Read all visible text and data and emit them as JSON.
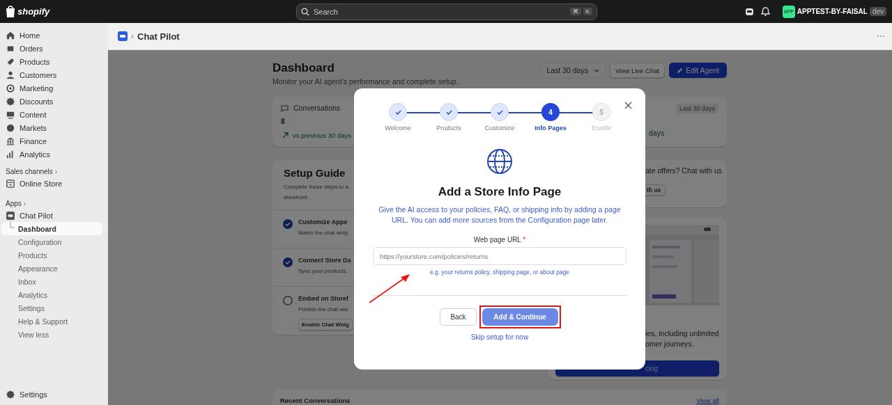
{
  "top_bar": {
    "logo_text": "shopify",
    "search": {
      "placeholder": "Search",
      "keys": [
        "⌘",
        "K"
      ]
    },
    "store": {
      "avatar": "APP",
      "name": "APPTEST-BY-FAISAL",
      "badge": "dev"
    }
  },
  "sidebar": {
    "main_items": [
      "Home",
      "Orders",
      "Products",
      "Customers",
      "Marketing",
      "Discounts",
      "Content",
      "Markets",
      "Finance",
      "Analytics"
    ],
    "sales_channels": {
      "heading": "Sales channels",
      "chevron": "›",
      "items": [
        "Online Store"
      ]
    },
    "apps": {
      "heading": "Apps",
      "chevron": "›",
      "app": "Chat Pilot",
      "children": [
        {
          "label": "Dashboard",
          "selected": true
        },
        {
          "label": "Configuration",
          "selected": false
        },
        {
          "label": "Products",
          "selected": false
        },
        {
          "label": "Appearance",
          "selected": false
        },
        {
          "label": "Inbox",
          "selected": false
        },
        {
          "label": "Analytics",
          "selected": false
        },
        {
          "label": "Settings",
          "selected": false
        },
        {
          "label": "Help & Support",
          "selected": false
        }
      ],
      "more": "View less"
    },
    "settings": "Settings"
  },
  "header": {
    "separator": "›",
    "app_name": "Chat Pilot"
  },
  "dashboard": {
    "title": "Dashboard",
    "subtitle": "Monitor your AI agent's performance and complete setup.",
    "date_filter": "Last 30 days",
    "buttons": [
      "View Live Chat",
      "Edit Agent"
    ],
    "stats_card": {
      "label": "Conversations",
      "value": "8",
      "trend": "vs previous 30 days",
      "badge": "Last 30 days",
      "trend_2": "days"
    },
    "setup_guide": {
      "title": "Setup Guide",
      "description_lines": [
        "Complete these steps to a",
        "storefront."
      ],
      "steps": [
        {
          "title": "Customize Appe",
          "description": "Match the chat widg",
          "done": true
        },
        {
          "title": "Connect Store Da",
          "description": "Sync your products,",
          "done": true
        },
        {
          "title": "Embed on Storef",
          "description": "Publish the chat wid",
          "done": false,
          "action": "Enable Chat Widg"
        }
      ]
    },
    "promo_card": {
      "text": "ate offers? Chat with us",
      "button": "th us"
    },
    "plan_card": {
      "text_lines": [
        "ies, including unlimited",
        "omer journeys."
      ],
      "button": "cing"
    },
    "recent": {
      "title": "Recent Conversations",
      "link": "View all"
    }
  },
  "modal": {
    "steps": [
      {
        "label": "Welcome",
        "kind": "done"
      },
      {
        "label": "Products",
        "kind": "done"
      },
      {
        "label": "Customize",
        "kind": "done"
      },
      {
        "label": "Info Pages",
        "kind": "current",
        "number": "4"
      },
      {
        "label": "Enable",
        "kind": "upcoming",
        "number": "5"
      }
    ],
    "title": "Add a Store Info Page",
    "description": "Give the AI access to your policies, FAQ, or shipping info by adding a page URL. You can add more sources from the Configuration page later.",
    "field": {
      "label": "Web page URL",
      "required_mark": "*",
      "placeholder": "https://yourstore.com/policies/returns",
      "hint": "e.g. your returns policy, shipping page, or about page"
    },
    "back_button": "Back",
    "primary_button": "Add & Continue",
    "skip_link": "Skip setup for now"
  }
}
